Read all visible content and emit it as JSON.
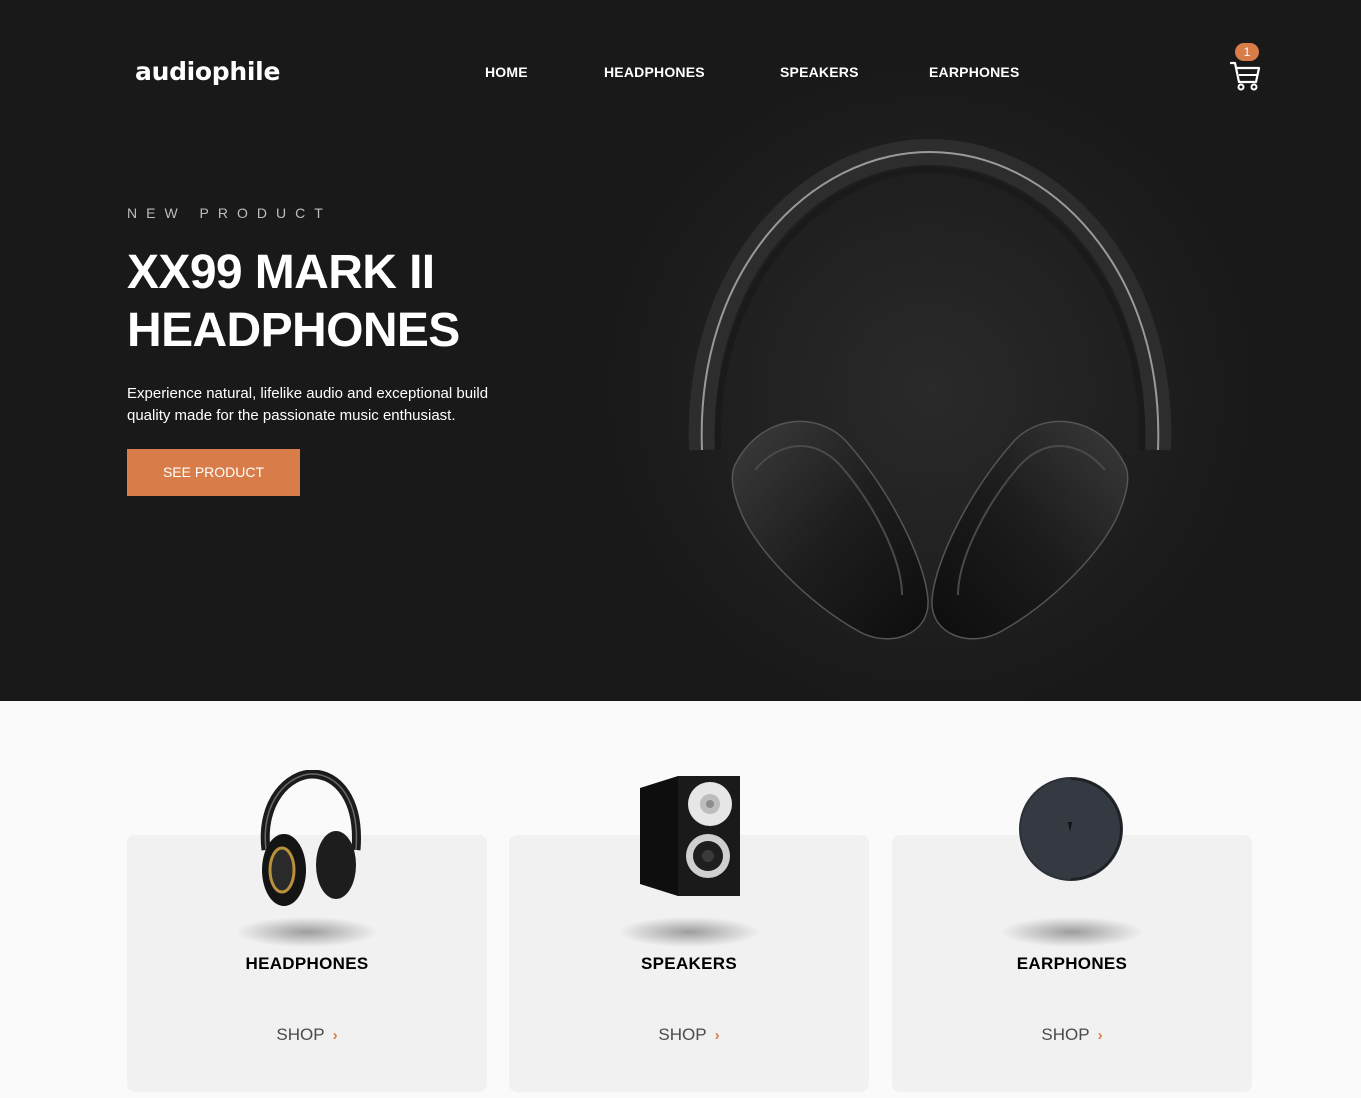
{
  "header": {
    "logo": "audiophile",
    "nav": [
      {
        "label": "HOME"
      },
      {
        "label": "HEADPHONES"
      },
      {
        "label": "SPEAKERS"
      },
      {
        "label": "EARPHONES"
      }
    ],
    "cart": {
      "count": "1",
      "icon": "cart-icon"
    }
  },
  "hero": {
    "overline": "NEW PRODUCT",
    "title_line1": "XX99 MARK II",
    "title_line2": "HEADPHONES",
    "description": "Experience natural, lifelike audio and exceptional build quality made for the passionate music enthusiast.",
    "cta": "SEE PRODUCT"
  },
  "categories": [
    {
      "title": "HEADPHONES",
      "shop": "SHOP",
      "icon": "chevron-right-icon"
    },
    {
      "title": "SPEAKERS",
      "shop": "SHOP",
      "icon": "chevron-right-icon"
    },
    {
      "title": "EARPHONES",
      "shop": "SHOP",
      "icon": "chevron-right-icon"
    }
  ],
  "colors": {
    "accent": "#d87d4a",
    "hero_bg": "#191919",
    "card_bg": "#f1f1f1",
    "page_bg": "#fafafa"
  }
}
